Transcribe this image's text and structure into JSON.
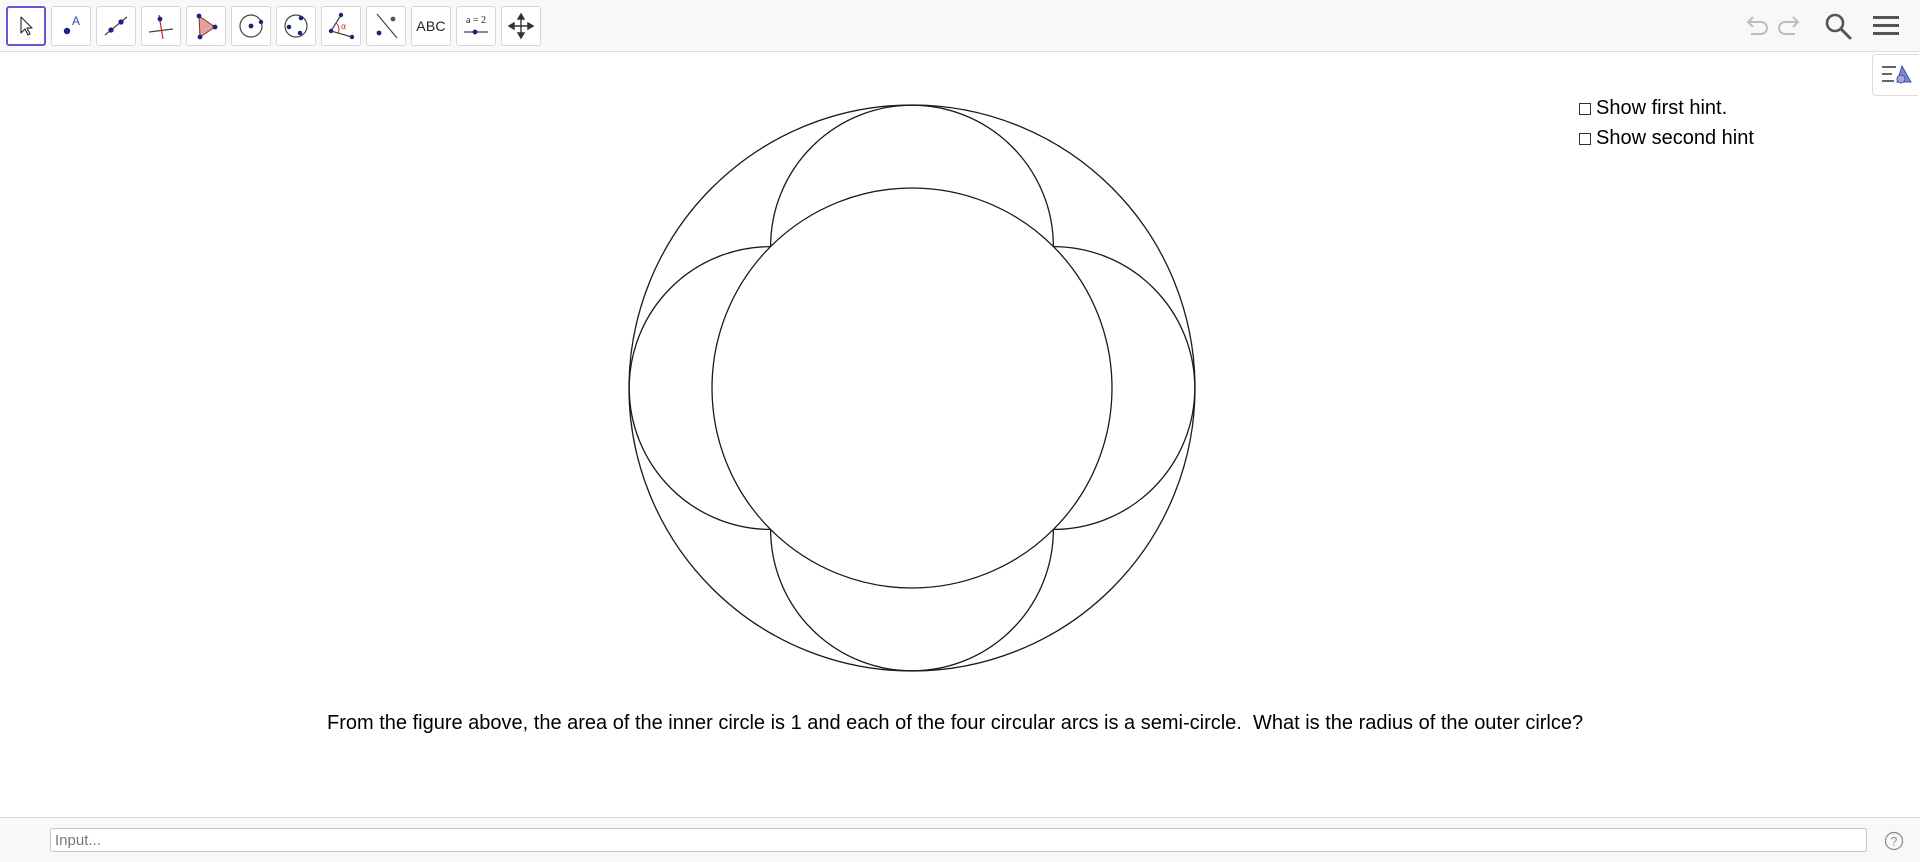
{
  "toolbar": {
    "tools": [
      {
        "id": "move",
        "icon": "cursor-arrow-icon",
        "selected": true
      },
      {
        "id": "point",
        "icon": "point-icon",
        "letter": "A"
      },
      {
        "id": "line",
        "icon": "line-through-points-icon"
      },
      {
        "id": "perpendicular",
        "icon": "perpendicular-line-icon"
      },
      {
        "id": "polygon",
        "icon": "polygon-icon"
      },
      {
        "id": "circle-center-point",
        "icon": "circle-center-icon"
      },
      {
        "id": "circle-three-points",
        "icon": "circle-three-points-icon"
      },
      {
        "id": "angle",
        "icon": "angle-icon",
        "symbol": "α"
      },
      {
        "id": "reflect",
        "icon": "reflect-line-icon"
      },
      {
        "id": "text",
        "icon": "text-icon",
        "label": "ABC"
      },
      {
        "id": "slider",
        "icon": "slider-icon",
        "label": "a = 2"
      },
      {
        "id": "move-graphics",
        "icon": "move-graphics-view-icon"
      }
    ],
    "right": [
      "undo-icon",
      "redo-icon",
      "search-icon",
      "menu-icon"
    ],
    "accent_color": "#6557d2"
  },
  "graphics": {
    "hints": [
      {
        "label": "Show first hint.",
        "checked": false
      },
      {
        "label": "Show second hint",
        "checked": false
      }
    ],
    "question": "From the figure above, the area of the inner circle is 1 and each of the four circular arcs is a semi-circle.  What is the radius of the outer cirlce?"
  },
  "input_bar": {
    "placeholder": "Input..."
  }
}
